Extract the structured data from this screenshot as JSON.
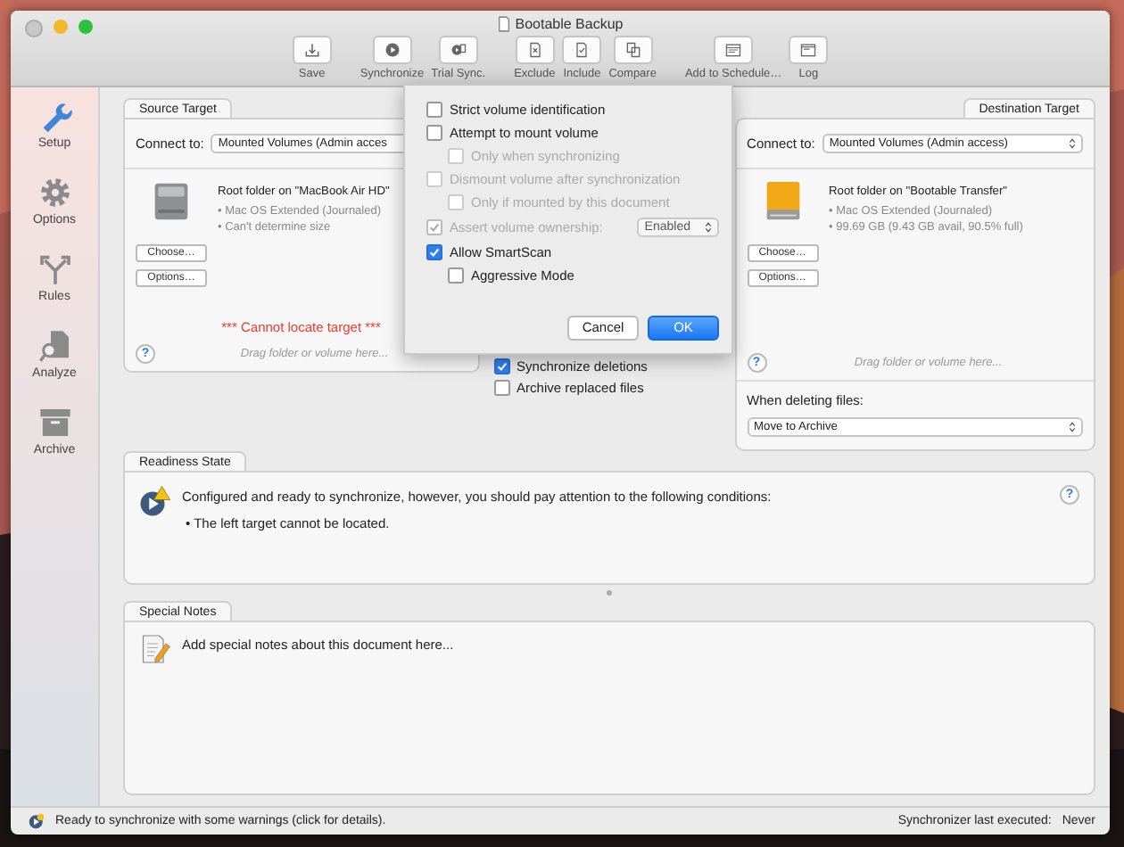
{
  "window": {
    "title": "Bootable Backup"
  },
  "toolbar": [
    {
      "items": [
        {
          "label": "Save",
          "kind": "save"
        }
      ]
    },
    {
      "items": [
        {
          "label": "Synchronize",
          "kind": "play"
        },
        {
          "label": "Trial Sync.",
          "kind": "trial"
        }
      ]
    },
    {
      "items": [
        {
          "label": "Exclude",
          "kind": "exclude"
        },
        {
          "label": "Include",
          "kind": "include"
        },
        {
          "label": "Compare",
          "kind": "compare"
        }
      ]
    },
    {
      "items": [
        {
          "label": "Add to Schedule…",
          "kind": "schedule"
        },
        {
          "label": "Log",
          "kind": "log"
        }
      ]
    }
  ],
  "sidebar": [
    {
      "label": "Setup",
      "kind": "wrench",
      "selected": true
    },
    {
      "label": "Options",
      "kind": "gear",
      "selected": false
    },
    {
      "label": "Rules",
      "kind": "fork",
      "selected": false
    },
    {
      "label": "Analyze",
      "kind": "analyze",
      "selected": false
    },
    {
      "label": "Archive",
      "kind": "archive",
      "selected": false
    }
  ],
  "source": {
    "tab": "Source Target",
    "connect_label": "Connect to:",
    "connect_value": "Mounted Volumes (Admin acces",
    "kind": "internal",
    "title": "Root folder on \"MacBook Air HD\"",
    "details": [
      "• Mac OS Extended (Journaled)",
      "• Can't determine size"
    ],
    "buttons": [
      "Choose…",
      "Options…"
    ],
    "error": "*** Cannot locate target ***",
    "help": "?",
    "drop_hint": "Drag folder or volume here..."
  },
  "middle_options": [
    {
      "label": "Synchronize deletions",
      "checked": true
    },
    {
      "label": "Archive replaced files",
      "checked": false
    }
  ],
  "destination": {
    "tab": "Destination Target",
    "connect_label": "Connect to:",
    "connect_value": "Mounted Volumes (Admin access)",
    "kind": "external",
    "title": "Root folder on \"Bootable Transfer\"",
    "details": [
      "• Mac OS Extended (Journaled)",
      "• 99.69 GB (9.43 GB avail, 90.5% full)"
    ],
    "buttons": [
      "Choose…",
      "Options…"
    ],
    "help": "?",
    "drop_hint": "Drag folder or volume here...",
    "deleting_label": "When deleting files:",
    "deleting_value": "Move to Archive"
  },
  "readiness": {
    "tab": "Readiness State",
    "message": "Configured and ready to synchronize, however, you should pay attention to the following conditions:",
    "bullets": [
      "• The left target cannot be located."
    ],
    "help": "?"
  },
  "notes": {
    "tab": "Special Notes",
    "placeholder": "Add special notes about this document here..."
  },
  "status_bar": {
    "message": "Ready to synchronize with some warnings (click for details).",
    "last_label": "Synchronizer last executed:",
    "last_value": "Never"
  },
  "popover": {
    "options": [
      {
        "label": "Strict volume identification",
        "checked": false,
        "disabled": false
      },
      {
        "label": "Attempt to mount volume",
        "checked": false,
        "disabled": false,
        "children": [
          {
            "label": "Only when synchronizing",
            "checked": false,
            "disabled": true
          }
        ]
      },
      {
        "label": "Dismount volume after synchronization",
        "checked": false,
        "disabled": true,
        "children": [
          {
            "label": "Only if mounted by this document",
            "checked": false,
            "disabled": true
          }
        ]
      },
      {
        "label": "Assert volume ownership:",
        "checked": true,
        "disabled": true,
        "select": "Enabled"
      },
      {
        "label": "Allow SmartScan",
        "checked": true,
        "disabled": false,
        "children": [
          {
            "label": "Aggressive Mode",
            "checked": false,
            "disabled": false
          }
        ]
      }
    ],
    "buttons": [
      {
        "label": "Cancel",
        "default": false
      },
      {
        "label": "OK",
        "default": true
      }
    ]
  }
}
